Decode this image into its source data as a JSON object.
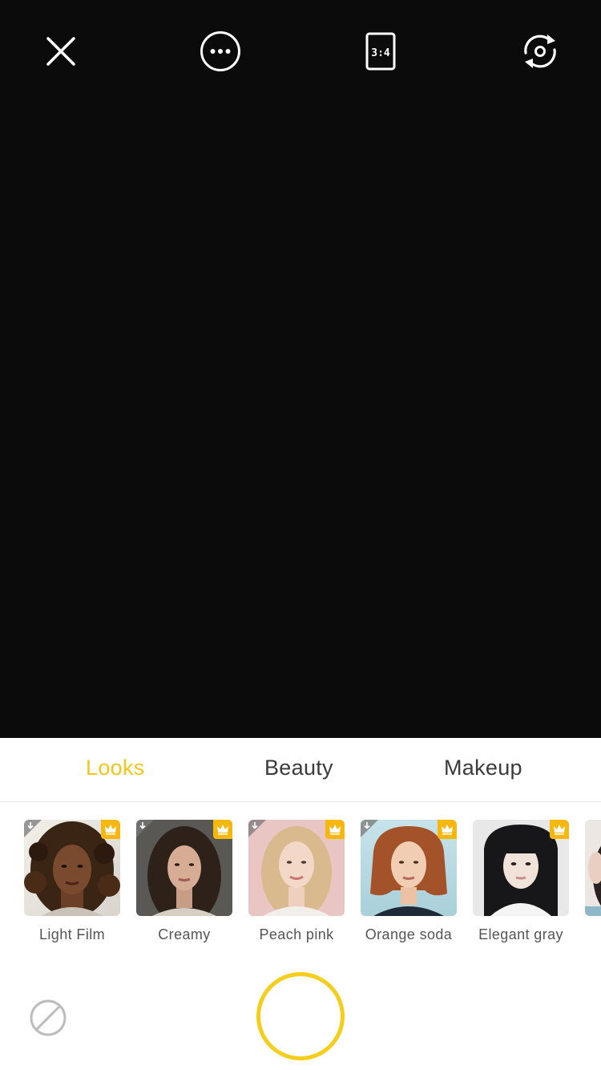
{
  "toolbar": {
    "close_icon": "close-icon",
    "more_icon": "more-options-icon",
    "aspect_ratio_label": "3:4",
    "flip_icon": "flip-camera-icon"
  },
  "tabs": [
    {
      "label": "Looks",
      "active": true
    },
    {
      "label": "Beauty",
      "active": false
    },
    {
      "label": "Makeup",
      "active": false
    }
  ],
  "filters": [
    {
      "label": "Light Film",
      "downloadable": true,
      "premium": true
    },
    {
      "label": "Creamy",
      "downloadable": true,
      "premium": true
    },
    {
      "label": "Peach pink",
      "downloadable": true,
      "premium": true
    },
    {
      "label": "Orange soda",
      "downloadable": true,
      "premium": true
    },
    {
      "label": "Elegant gray",
      "downloadable": false,
      "premium": true
    }
  ],
  "controls": {
    "no_filter_icon": "no-filter-icon",
    "shutter": "shutter-button"
  },
  "colors": {
    "accent": "#f5c518",
    "premium_badge": "#f6b70f",
    "viewfinder": "#0b0b0c",
    "tab_text": "#3b3b3b"
  }
}
